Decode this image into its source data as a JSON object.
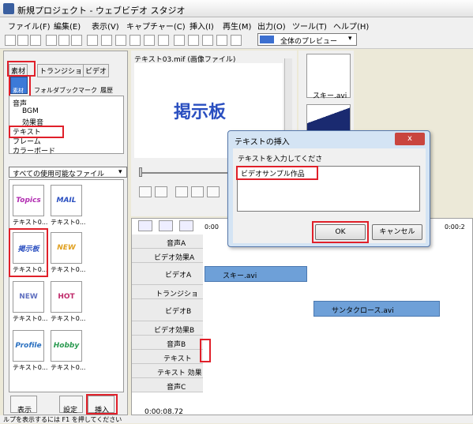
{
  "window": {
    "title": "新規プロジェクト - ウェブビデオ スタジオ"
  },
  "menu": [
    "ファイル(F)",
    "編集(E)",
    "表示(V)",
    "キャプチャー(C)",
    "挿入(I)",
    "再生(M)",
    "出力(O)",
    "ツール(T)",
    "ヘルプ(H)"
  ],
  "toolbar": {
    "preview_label": "全体のプレビュー"
  },
  "left": {
    "tabs": [
      "素材",
      "トランジション",
      "ビデオ"
    ],
    "subtabs": [
      "素材",
      "フォルダ",
      "ブックマーク",
      "履歴"
    ],
    "tree": [
      "音声",
      "BGM",
      "効果音",
      "テキスト",
      "フレーム",
      "カラーボード"
    ],
    "filter": "すべての使用可能なファイル",
    "thumbs": [
      {
        "art": "Topics",
        "label": "テキスト0..."
      },
      {
        "art": "MAIL",
        "label": "テキスト0..."
      },
      {
        "art": "掲示板",
        "label": "テキスト0..."
      },
      {
        "art": "NEW",
        "label": "テキスト0..."
      },
      {
        "art": "NEW",
        "label": "テキスト0..."
      },
      {
        "art": "HOT",
        "label": "テキスト0..."
      },
      {
        "art": "Profile",
        "label": "テキスト0..."
      },
      {
        "art": "Hobby",
        "label": "テキスト0..."
      }
    ],
    "buttons": [
      "表示",
      "設定",
      "挿入"
    ]
  },
  "preview": {
    "filename": "テキスト03.mif (画像ファイル)",
    "art": "掲示板"
  },
  "library": {
    "item1": "スキー.avi"
  },
  "timeline": {
    "time": "0:00:08.72",
    "ruler": [
      "0:00",
      "0:00:2"
    ],
    "tracks": [
      "音声A",
      "ビデオ効果A",
      "ビデオA",
      "トランジション",
      "ビデオB",
      "ビデオ効果B",
      "音声B",
      "テキスト",
      "テキスト 効果",
      "音声C"
    ],
    "clips": {
      "a": "スキー.avi",
      "b": "サンタクロース.avi"
    }
  },
  "dialog": {
    "title": "テキストの挿入",
    "prompt": "テキストを入力してくださ",
    "value": "ビデオサンプル作品",
    "ok": "OK",
    "cancel": "キャンセル"
  },
  "status": "ルプを表示するには F1 を押してください"
}
